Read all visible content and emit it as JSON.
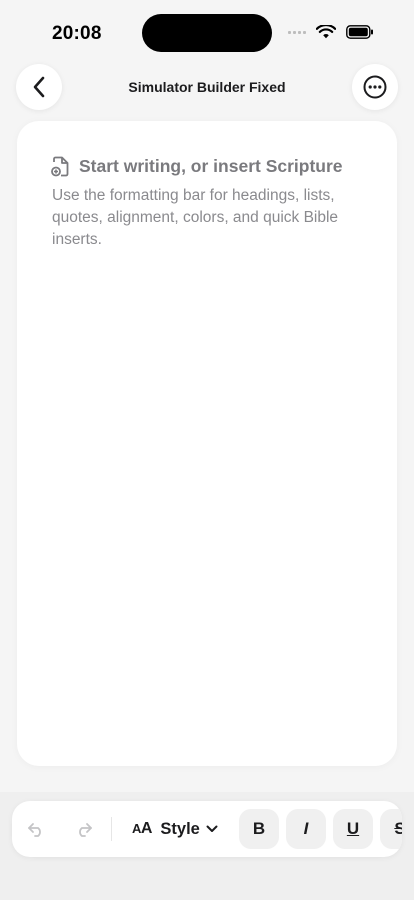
{
  "status_bar": {
    "time": "20:08"
  },
  "nav": {
    "title": "Simulator Builder Fixed",
    "back_icon": "chevron-left-icon",
    "more_icon": "ellipsis-circle-icon"
  },
  "editor": {
    "placeholder_title": "Start writing, or insert Scripture",
    "placeholder_body": "Use the formatting bar for headings, lists, quotes, alignment, colors, and quick Bible inserts."
  },
  "toolbar": {
    "style_small": "A",
    "style_big": "A",
    "style_label": "Style",
    "bold": "B",
    "italic": "I",
    "underline": "U",
    "strike": "S"
  }
}
